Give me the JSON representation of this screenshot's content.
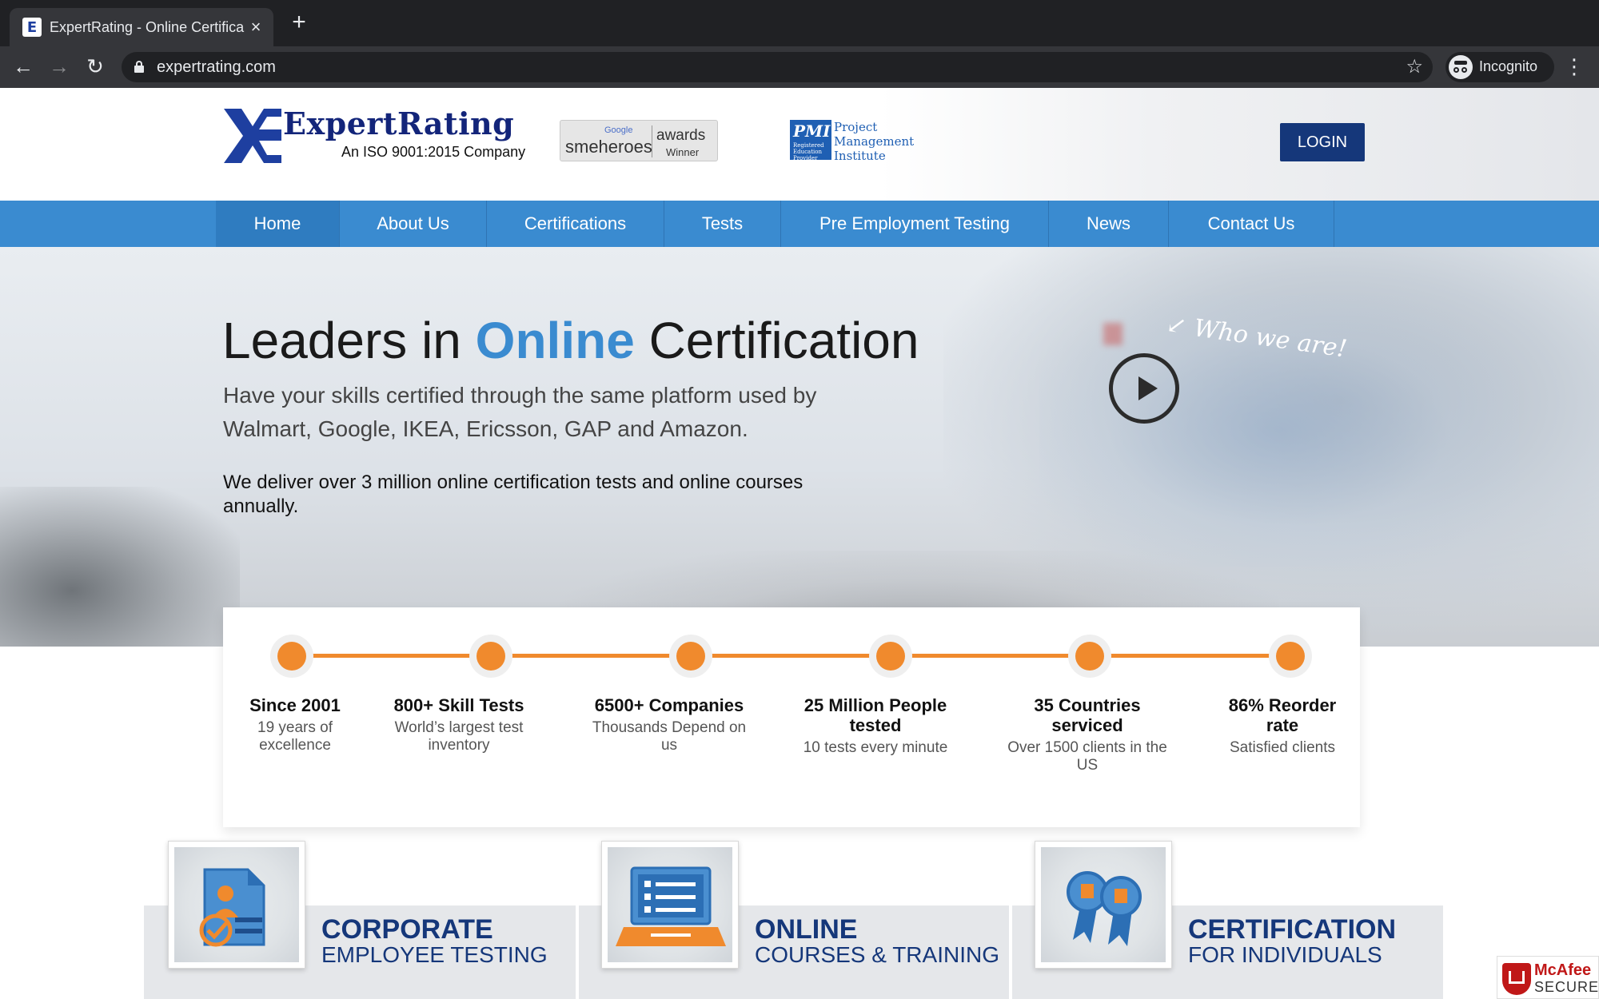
{
  "browser": {
    "tab_title": "ExpertRating - Online Certifica",
    "favicon": "E",
    "url": "expertrating.com",
    "incognito_label": "Incognito"
  },
  "header": {
    "logo_name": "ExpertRating",
    "logo_sub": "An ISO 9001:2015 Company",
    "sme_google": "Google",
    "sme_heroes": "smeheroes",
    "sme_awards": "awards",
    "sme_winner": "Winner",
    "pmi_mark": "PMI",
    "pmi_mark_small": "Registered Education Provider",
    "pmi_text": "Project Management Institute",
    "login_label": "LOGIN"
  },
  "nav": {
    "items": [
      {
        "label": "Home",
        "active": true
      },
      {
        "label": "About Us"
      },
      {
        "label": "Certifications"
      },
      {
        "label": "Tests"
      },
      {
        "label": "Pre Employment Testing"
      },
      {
        "label": "News"
      },
      {
        "label": "Contact Us"
      }
    ]
  },
  "hero": {
    "title_pre": "Leaders in ",
    "title_highlight": "Online",
    "title_post": " Certification",
    "subtitle": "Have your skills certified through the same platform used by Walmart, Google, IKEA, Ericsson, GAP and Amazon.",
    "body": "We deliver over 3 million online certification tests and online courses annually.",
    "video_label": "Who we are!"
  },
  "stats": [
    {
      "title": "Since 2001",
      "sub": "19 years of excellence"
    },
    {
      "title": "800+ Skill Tests",
      "sub": "World’s largest test inventory"
    },
    {
      "title": "6500+ Companies",
      "sub": "Thousands Depend on us"
    },
    {
      "title": "25 Million People tested",
      "sub": "10 tests every minute"
    },
    {
      "title": "35 Countries serviced",
      "sub": "Over 1500 clients in the US"
    },
    {
      "title": "86% Reorder rate",
      "sub": "Satisfied clients"
    }
  ],
  "services": [
    {
      "title": "CORPORATE",
      "sub": "EMPLOYEE TESTING",
      "icon": "employee-test-icon"
    },
    {
      "title": "ONLINE",
      "sub": "COURSES & TRAINING",
      "icon": "laptop-checklist-icon"
    },
    {
      "title": "CERTIFICATION",
      "sub": "FOR INDIVIDUALS",
      "icon": "award-ribbon-icon"
    }
  ],
  "mcafee": {
    "name": "McAfee",
    "secure": "SECURE"
  },
  "colors": {
    "brand_navy": "#15377a",
    "nav_blue": "#3a8bd0",
    "timeline_orange": "#f08a2d"
  }
}
